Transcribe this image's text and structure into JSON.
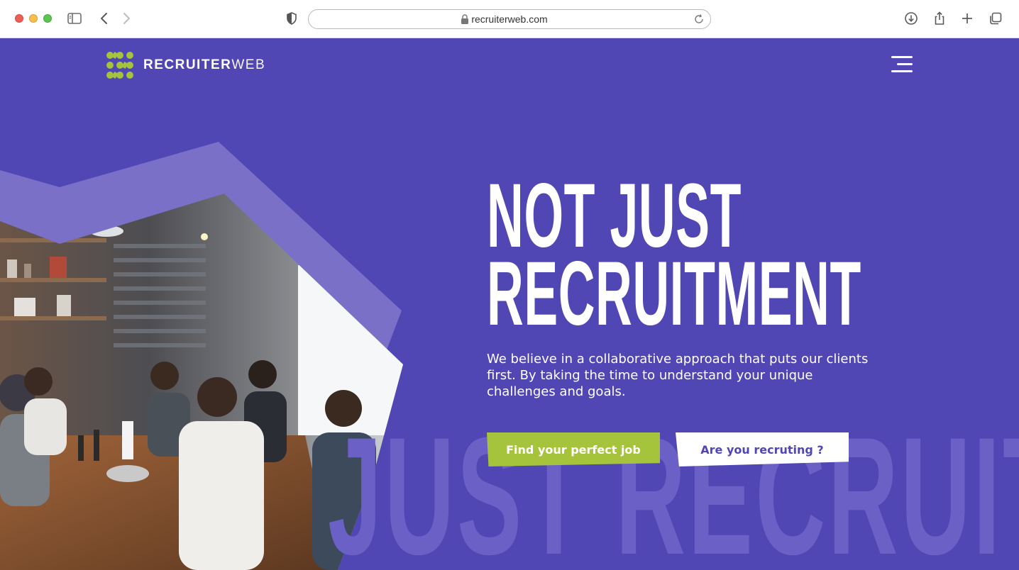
{
  "browser": {
    "url": "recruiterweb.com"
  },
  "header": {
    "logo_text_bold": "RECRUITER",
    "logo_text_light": "WEB"
  },
  "hero": {
    "headline_line1": "NOT JUST",
    "headline_line2": "RECRUITMENT",
    "description": "We believe in a collaborative approach that puts our clients first. By taking the time to understand your unique challenges and goals.",
    "primary_cta": "Find your perfect job",
    "secondary_cta": "Are you recruting ?",
    "watermark": "JUST RECRUITM"
  },
  "colors": {
    "background": "#5046b4",
    "accent_green": "#a6c33c",
    "shape_light": "#7a70c8"
  },
  "icons": {
    "sidebar": "sidebar-icon",
    "back": "chevron-left-icon",
    "forward": "chevron-right-icon",
    "privacy": "shield-icon",
    "lock": "lock-icon",
    "reload": "reload-icon",
    "download": "download-icon",
    "share": "share-icon",
    "new_tab": "plus-icon",
    "tabs": "tabs-icon",
    "menu": "hamburger-menu-icon"
  }
}
